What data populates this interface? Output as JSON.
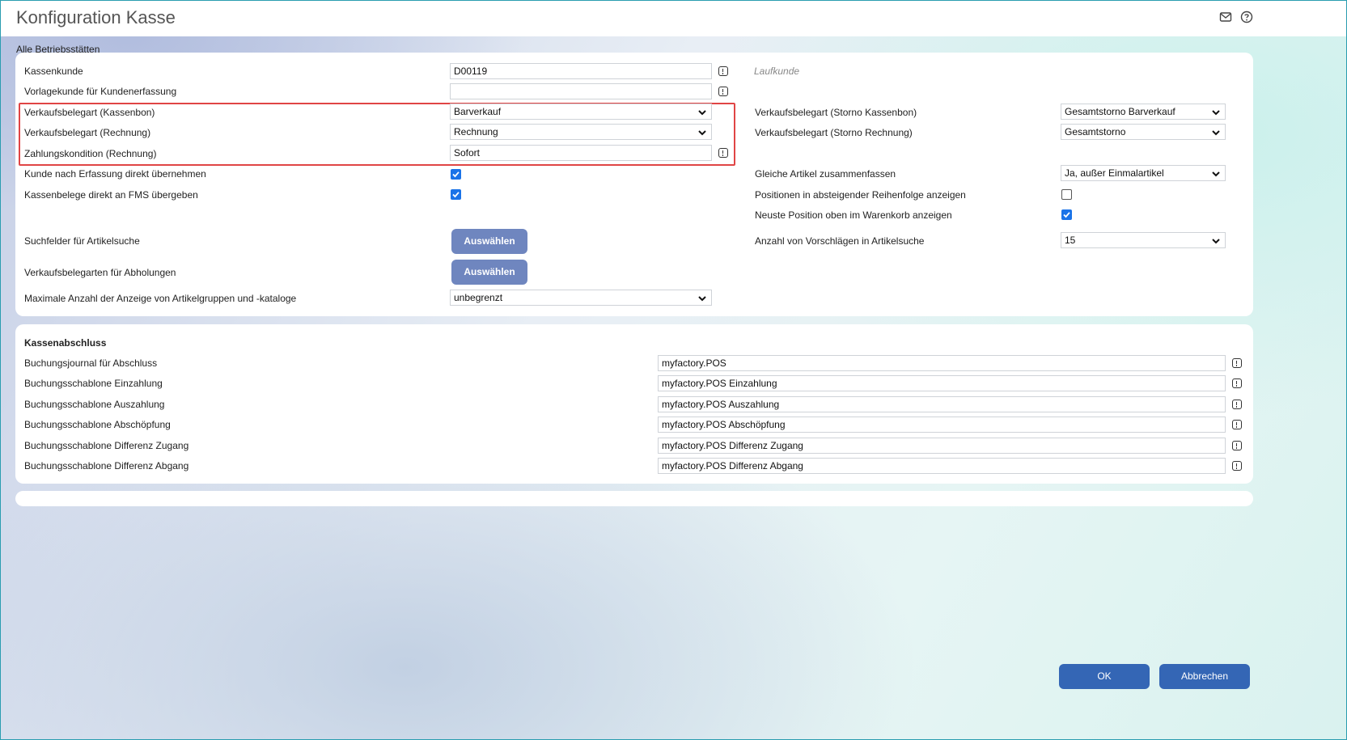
{
  "header": {
    "title": "Konfiguration Kasse",
    "icons": [
      "mail-icon",
      "help-icon"
    ]
  },
  "scope_label": "Alle Betriebsstätten",
  "config": {
    "kassenkunde_label": "Kassenkunde",
    "kassenkunde_value": "D00119",
    "kassenkunde_name": "Laufkunde",
    "vorlagekunde_label": "Vorlagekunde für Kundenerfassung",
    "vorlagekunde_value": "",
    "vk_kassenbon_label": "Verkaufsbelegart (Kassenbon)",
    "vk_kassenbon_value": "Barverkauf",
    "vk_rechnung_label": "Verkaufsbelegart (Rechnung)",
    "vk_rechnung_value": "Rechnung",
    "zahlungskondition_label": "Zahlungskondition (Rechnung)",
    "zahlungskondition_value": "Sofort",
    "kunde_uebernehmen_label": "Kunde nach Erfassung direkt übernehmen",
    "kunde_uebernehmen_checked": true,
    "kassenbelege_fms_label": "Kassenbelege direkt an FMS übergeben",
    "kassenbelege_fms_checked": true,
    "suchfelder_label": "Suchfelder für Artikelsuche",
    "suchfelder_button": "Auswählen",
    "abholungen_label": "Verkaufsbelegarten für Abholungen",
    "abholungen_button": "Auswählen",
    "max_anzahl_label": "Maximale Anzahl der Anzeige von Artikelgruppen und -kataloge",
    "max_anzahl_value": "unbegrenzt",
    "storno_kassenbon_label": "Verkaufsbelegart (Storno Kassenbon)",
    "storno_kassenbon_value": "Gesamtstorno Barverkauf",
    "storno_rechnung_label": "Verkaufsbelegart (Storno Rechnung)",
    "storno_rechnung_value": "Gesamtstorno",
    "gleiche_artikel_label": "Gleiche Artikel zusammenfassen",
    "gleiche_artikel_value": "Ja, außer Einmalartikel",
    "absteigend_label": "Positionen in absteigender Reihenfolge anzeigen",
    "absteigend_checked": false,
    "neuste_oben_label": "Neuste Position oben im Warenkorb anzeigen",
    "neuste_oben_checked": true,
    "vorschlaege_label": "Anzahl von Vorschlägen in Artikelsuche",
    "vorschlaege_value": "15"
  },
  "kassenabschluss": {
    "heading": "Kassenabschluss",
    "rows": [
      {
        "label": "Buchungsjournal für Abschluss",
        "value": "myfactory.POS"
      },
      {
        "label": "Buchungsschablone Einzahlung",
        "value": "myfactory.POS Einzahlung"
      },
      {
        "label": "Buchungsschablone Auszahlung",
        "value": "myfactory.POS Auszahlung"
      },
      {
        "label": "Buchungsschablone Abschöpfung",
        "value": "myfactory.POS Abschöpfung"
      },
      {
        "label": "Buchungsschablone Differenz Zugang",
        "value": "myfactory.POS Differenz Zugang"
      },
      {
        "label": "Buchungsschablone Differenz Abgang",
        "value": "myfactory.POS Differenz Abgang"
      }
    ]
  },
  "footer": {
    "ok_label": "OK",
    "cancel_label": "Abbrechen"
  },
  "colors": {
    "accent": "#3466b5",
    "select_button": "#6f86bf",
    "highlight": "#e04545",
    "checkbox": "#1a73e8"
  }
}
